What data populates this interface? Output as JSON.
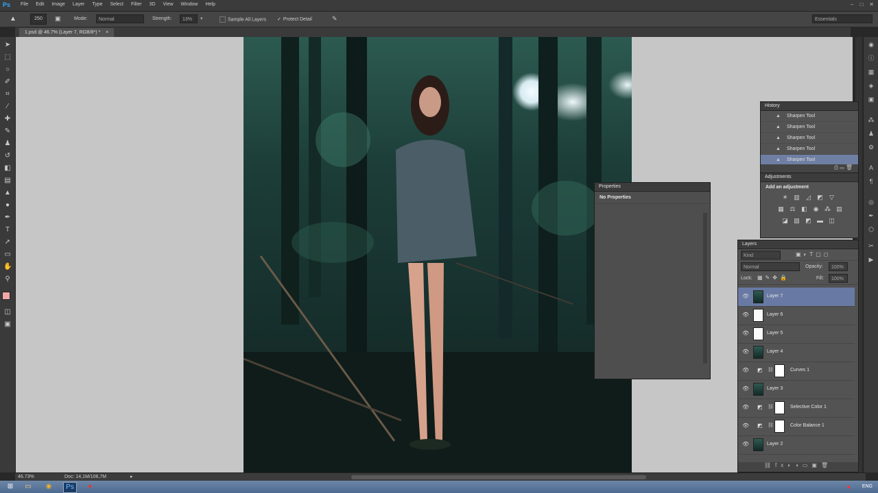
{
  "app": {
    "logo": "Ps"
  },
  "menu": [
    "File",
    "Edit",
    "Image",
    "Layer",
    "Type",
    "Select",
    "Filter",
    "3D",
    "View",
    "Window",
    "Help"
  ],
  "window_controls": [
    "–",
    "□",
    "✕"
  ],
  "options": {
    "brush_size": "250",
    "mode_label": "Mode:",
    "mode_value": "Normal",
    "strength_label": "Strength:",
    "strength_value": "13%",
    "sample_all_layers": "Sample All Layers",
    "protect_detail": "Protect Detail",
    "workspace": "Essentials"
  },
  "document": {
    "tab": "1.psd @ 46.7% (Layer 7, RGB/8*) *"
  },
  "history": {
    "title": "History",
    "items": [
      "Sharpen Tool",
      "Sharpen Tool",
      "Sharpen Tool",
      "Sharpen Tool",
      "Sharpen Tool"
    ]
  },
  "adjustments": {
    "title": "Adjustments",
    "heading": "Add an adjustment"
  },
  "properties": {
    "title": "Properties",
    "body": "No Properties"
  },
  "layers": {
    "title": "Layers",
    "filter": "Kind",
    "blend": "Normal",
    "opacity_label": "Opacity:",
    "opacity": "100%",
    "lock_label": "Lock:",
    "fill_label": "Fill:",
    "fill": "100%",
    "items": [
      {
        "name": "Layer 7",
        "kind": "photo",
        "selected": true
      },
      {
        "name": "Layer 6",
        "kind": "white"
      },
      {
        "name": "Layer 5",
        "kind": "white"
      },
      {
        "name": "Layer 4",
        "kind": "photo"
      },
      {
        "name": "Curves 1",
        "kind": "adjust"
      },
      {
        "name": "Layer 3",
        "kind": "photo"
      },
      {
        "name": "Selective Color 1",
        "kind": "adjust"
      },
      {
        "name": "Color Balance 1",
        "kind": "adjust"
      },
      {
        "name": "Layer 2",
        "kind": "photo"
      }
    ]
  },
  "status": {
    "zoom": "46.73%",
    "doc": "Doc: 14,1M/106,7M"
  },
  "taskbar": {
    "lang": "ENG"
  },
  "colors": {
    "selection": "#687aa4",
    "foreground_swatch": "#f0a8a8",
    "background_swatch": "#111111"
  }
}
